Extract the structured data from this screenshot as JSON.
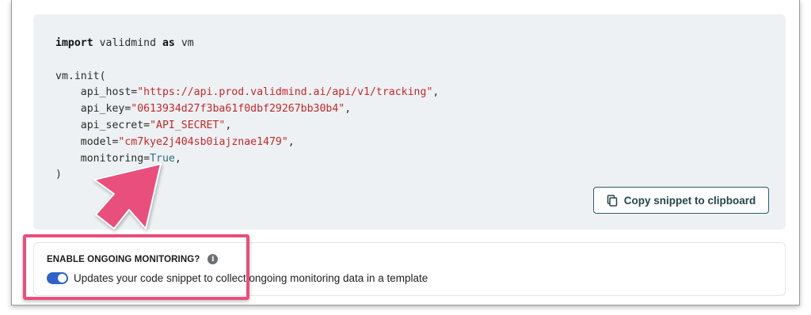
{
  "code": {
    "line1_kw1": "import",
    "line1_mid": " validmind ",
    "line1_kw2": "as",
    "line1_end": " vm",
    "line2": "vm.init(",
    "host_key": "    api_host=",
    "host_val": "\"https://api.prod.validmind.ai/api/v1/tracking\"",
    "apikey_key": "    api_key=",
    "apikey_val": "\"0613934d27f3ba61f0dbf29267bb30b4\"",
    "secret_key": "    api_secret=",
    "secret_val": "\"API_SECRET\"",
    "model_key": "    model=",
    "model_val": "\"cm7kye2j404sb0iajznae1479\"",
    "monitoring_key": "    monitoring=",
    "monitoring_val": "True",
    "close": ")"
  },
  "copy_button": {
    "label": "Copy snippet to clipboard",
    "icon": "copy-icon"
  },
  "monitoring": {
    "title": "ENABLE ONGOING MONITORING?",
    "info_icon": "i",
    "toggle_on": true,
    "description": "Updates your code snippet to collect ongoing monitoring data in a template"
  },
  "colors": {
    "highlight": "#e8507b",
    "string": "#c4282c",
    "toggle": "#2f62c9",
    "button_border": "#2f5c66"
  }
}
